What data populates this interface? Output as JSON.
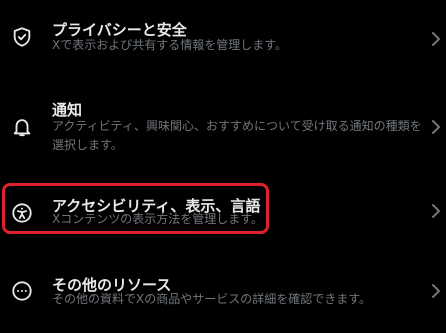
{
  "settings": {
    "items": [
      {
        "title": "プライバシーと安全",
        "description": "Xで表示および共有する情報を管理します。",
        "icon": "shield-check-icon"
      },
      {
        "title": "通知",
        "description": "アクティビティ、興味関心、おすすめについて受け取る通知の種類を選択します。",
        "icon": "bell-icon"
      },
      {
        "title": "アクセシビリティ、表示、言語",
        "description": "Xコンテンツの表示方法を管理します。",
        "icon": "accessibility-icon"
      },
      {
        "title": "その他のリソース",
        "description": "その他の資料でXの商品やサービスの詳細を確認できます。",
        "icon": "more-circle-icon"
      }
    ]
  },
  "colors": {
    "background": "#000000",
    "title": "#e7e9ea",
    "description": "#71767b",
    "highlight": "#e0202e"
  }
}
